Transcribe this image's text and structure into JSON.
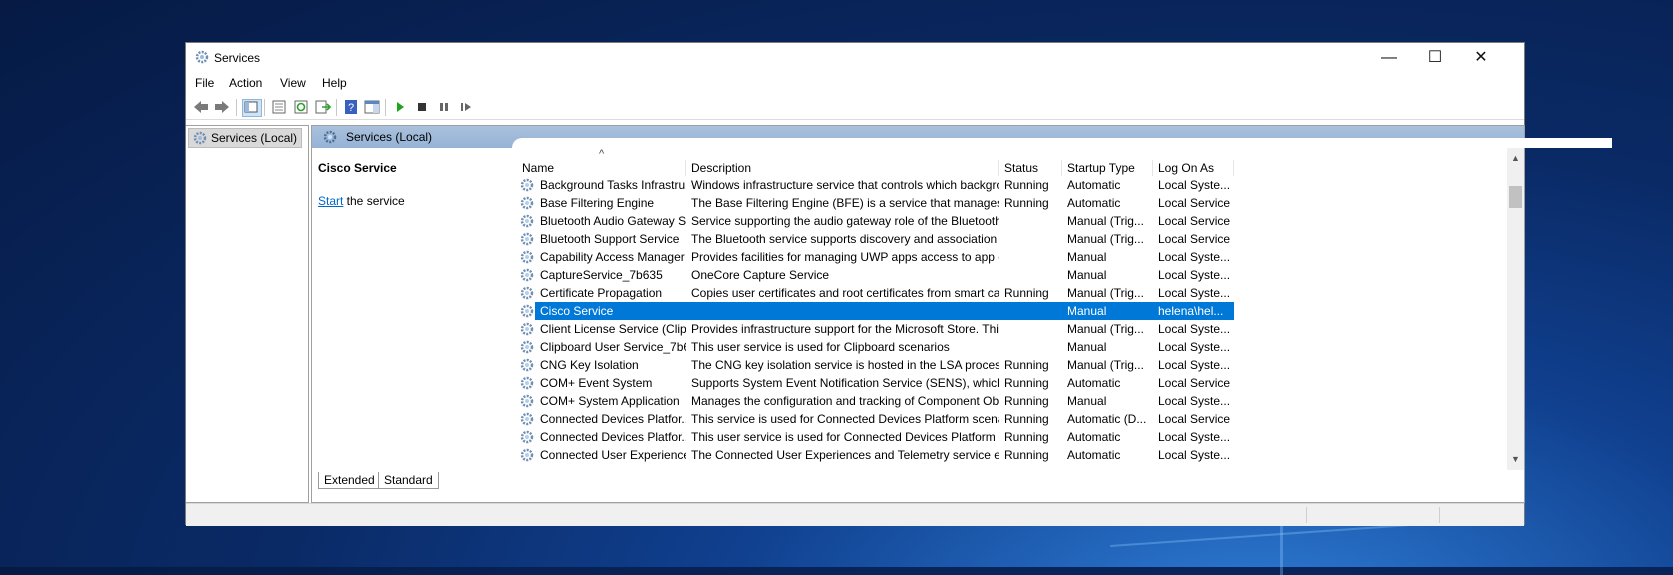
{
  "window": {
    "title": "Services",
    "app_icon": "gears-icon",
    "controls": {
      "minimize": "—",
      "maximize": "☐",
      "close": "✕"
    }
  },
  "menu": [
    "File",
    "Action",
    "View",
    "Help"
  ],
  "toolbar": {
    "buttons": [
      "back-arrow-icon",
      "forward-arrow-icon",
      "show-hide-console-tree-icon",
      "properties-icon",
      "refresh-icon",
      "export-list-icon",
      "help-icon",
      "show-action-pane-icon",
      "start-service-icon",
      "stop-service-icon",
      "pause-service-icon",
      "resume-service-icon"
    ]
  },
  "tree": {
    "root": "Services (Local)"
  },
  "pane": {
    "header": "Services (Local)",
    "selected_service": "Cisco Service",
    "action_link": "Start",
    "action_suffix": " the service"
  },
  "columns": [
    "Name",
    "Description",
    "Status",
    "Startup Type",
    "Log On As"
  ],
  "rows": [
    {
      "name": "Background Tasks Infrastru...",
      "description": "Windows infrastructure service that controls which backgro...",
      "status": "Running",
      "startup": "Automatic",
      "logon": "Local Syste..."
    },
    {
      "name": "Base Filtering Engine",
      "description": "The Base Filtering Engine (BFE) is a service that manages fir...",
      "status": "Running",
      "startup": "Automatic",
      "logon": "Local Service"
    },
    {
      "name": "Bluetooth Audio Gateway S...",
      "description": "Service supporting the audio gateway role of the Bluetooth ...",
      "status": "",
      "startup": "Manual (Trig...",
      "logon": "Local Service"
    },
    {
      "name": "Bluetooth Support Service",
      "description": "The Bluetooth service supports discovery and association o...",
      "status": "",
      "startup": "Manual (Trig...",
      "logon": "Local Service"
    },
    {
      "name": "Capability Access Manager ...",
      "description": "Provides facilities for managing UWP apps access to app ca...",
      "status": "",
      "startup": "Manual",
      "logon": "Local Syste..."
    },
    {
      "name": "CaptureService_7b635",
      "description": "OneCore Capture Service",
      "status": "",
      "startup": "Manual",
      "logon": "Local Syste..."
    },
    {
      "name": "Certificate Propagation",
      "description": "Copies user certificates and root certificates from smart car...",
      "status": "Running",
      "startup": "Manual (Trig...",
      "logon": "Local Syste..."
    },
    {
      "name": "Cisco Service",
      "description": "",
      "status": "",
      "startup": "Manual",
      "logon": "helena\\hel...",
      "selected": true
    },
    {
      "name": "Client License Service (ClipS...",
      "description": "Provides infrastructure support for the Microsoft Store. This...",
      "status": "",
      "startup": "Manual (Trig...",
      "logon": "Local Syste..."
    },
    {
      "name": "Clipboard User Service_7b635",
      "description": "This user service is used for Clipboard scenarios",
      "status": "",
      "startup": "Manual",
      "logon": "Local Syste..."
    },
    {
      "name": "CNG Key Isolation",
      "description": "The CNG key isolation service is hosted in the LSA process. ...",
      "status": "Running",
      "startup": "Manual (Trig...",
      "logon": "Local Syste..."
    },
    {
      "name": "COM+ Event System",
      "description": "Supports System Event Notification Service (SENS), which p...",
      "status": "Running",
      "startup": "Automatic",
      "logon": "Local Service"
    },
    {
      "name": "COM+ System Application",
      "description": "Manages the configuration and tracking of Component Ob...",
      "status": "Running",
      "startup": "Manual",
      "logon": "Local Syste..."
    },
    {
      "name": "Connected Devices Platfor...",
      "description": "This service is used for Connected Devices Platform scenari...",
      "status": "Running",
      "startup": "Automatic (D...",
      "logon": "Local Service"
    },
    {
      "name": "Connected Devices Platfor...",
      "description": "This user service is used for Connected Devices Platform sc...",
      "status": "Running",
      "startup": "Automatic",
      "logon": "Local Syste..."
    },
    {
      "name": "Connected User Experience...",
      "description": "The Connected User Experiences and Telemetry service ena...",
      "status": "Running",
      "startup": "Automatic",
      "logon": "Local Syste..."
    }
  ],
  "tabs": [
    "Extended",
    "Standard"
  ],
  "colors": {
    "selection": "#0078d7",
    "pane_header": "#9fbadb",
    "link": "#0066cc"
  }
}
